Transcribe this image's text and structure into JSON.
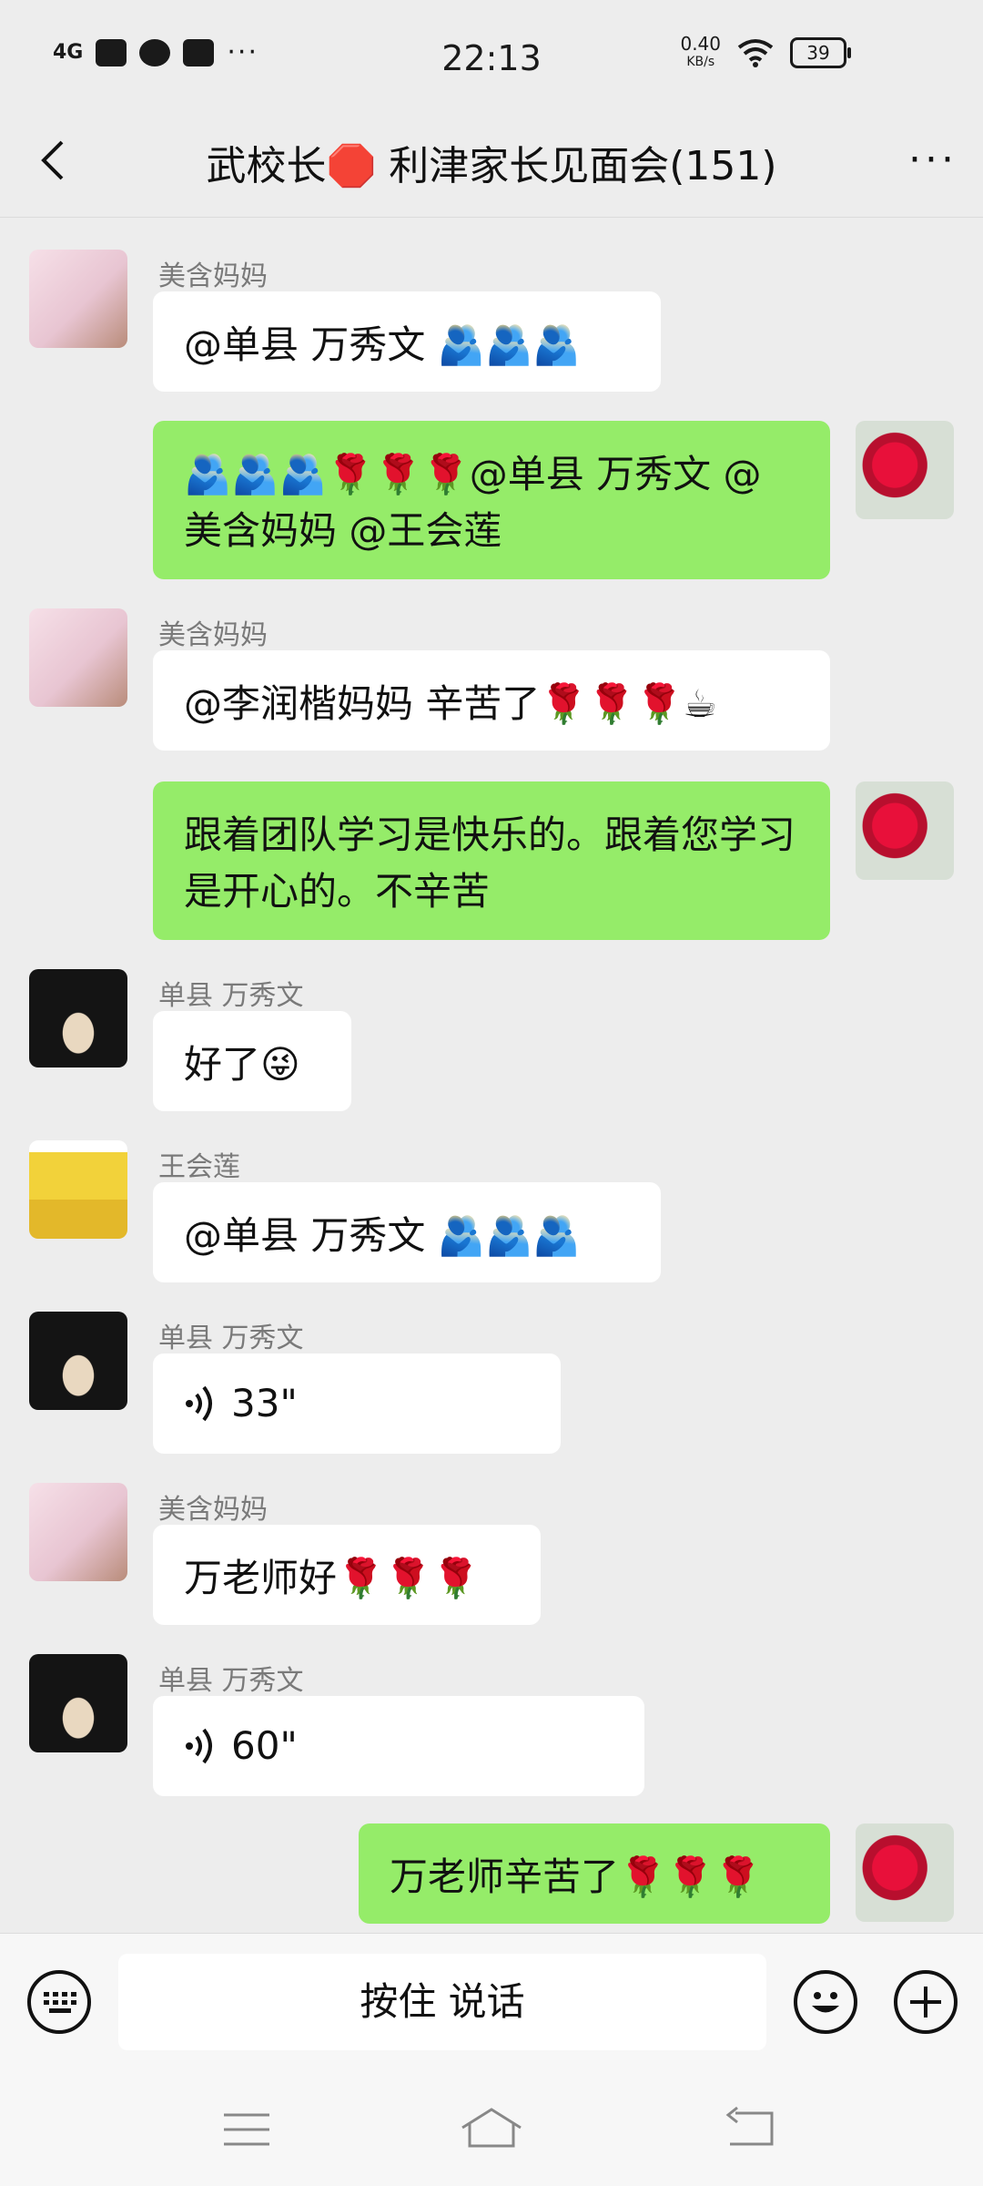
{
  "status_bar": {
    "network": "4G",
    "more": "···",
    "time": "22:13",
    "speed": "0.40",
    "speed_unit": "KB/s",
    "battery": "39"
  },
  "header": {
    "title": "武校长🛑 利津家长见面会(151)",
    "more": "···"
  },
  "messages": [
    {
      "sender": "美含妈妈",
      "text": "@单县  万秀文 🫂🫂🫂"
    },
    {
      "sender": "",
      "text": "🫂🫂🫂🌹🌹🌹@单县  万秀文 @美含妈妈 @王会莲"
    },
    {
      "sender": "美含妈妈",
      "text": "@李润楷妈妈  辛苦了🌹🌹🌹☕"
    },
    {
      "sender": "",
      "text": "跟着团队学习是快乐的。跟着您学习是开心的。不辛苦"
    },
    {
      "sender": "单县  万秀文",
      "text": "好了😜"
    },
    {
      "sender": "王会莲",
      "text": "@单县  万秀文 🫂🫂🫂"
    },
    {
      "sender": "单县  万秀文",
      "text": "33\""
    },
    {
      "sender": "美含妈妈",
      "text": "万老师好🌹🌹🌹"
    },
    {
      "sender": "单县  万秀文",
      "text": "60\""
    },
    {
      "sender": "",
      "text": "万老师辛苦了🌹🌹🌹"
    }
  ],
  "input_bar": {
    "hold_to_talk": "按住 说话"
  },
  "colors": {
    "background": "#ededed",
    "outgoing_bubble": "#95ec69",
    "incoming_bubble": "#ffffff"
  }
}
